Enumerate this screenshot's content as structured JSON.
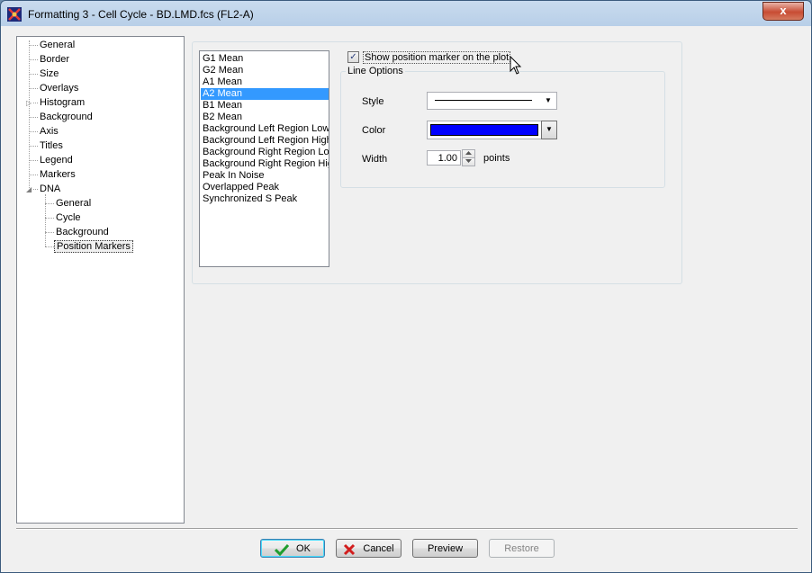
{
  "window": {
    "title": "Formatting 3 - Cell Cycle - BD.LMD.fcs (FL2-A)",
    "close_glyph": "x"
  },
  "tree": {
    "items": [
      {
        "label": "General"
      },
      {
        "label": "Border"
      },
      {
        "label": "Size"
      },
      {
        "label": "Overlays"
      },
      {
        "label": "Histogram"
      },
      {
        "label": "Background"
      },
      {
        "label": "Axis"
      },
      {
        "label": "Titles"
      },
      {
        "label": "Legend"
      },
      {
        "label": "Markers"
      },
      {
        "label": "DNA"
      }
    ],
    "dna_children": [
      {
        "label": "General"
      },
      {
        "label": "Cycle"
      },
      {
        "label": "Background"
      },
      {
        "label": "Position Markers"
      }
    ],
    "histogram_expander": "▷",
    "dna_expander": "◢"
  },
  "marker_list": {
    "items": [
      "G1 Mean",
      "G2 Mean",
      "A1 Mean",
      "A2 Mean",
      "B1 Mean",
      "B2 Mean",
      "Background Left Region Low",
      "Background Left Region High",
      "Background Right Region Low",
      "Background Right Region High",
      "Peak In Noise",
      "Overlapped Peak",
      "Synchronized S Peak"
    ],
    "selected": "A2 Mean"
  },
  "options": {
    "show_marker_label": "Show position marker on the plot",
    "show_marker_checked": "✓",
    "group_title": "Line Options",
    "style_label": "Style",
    "color_label": "Color",
    "color_value": "#0000ff",
    "width_label": "Width",
    "width_value": "1.00",
    "width_unit": "points",
    "dropdown_glyph": "▼"
  },
  "buttons": {
    "ok": "OK",
    "cancel": "Cancel",
    "preview": "Preview",
    "restore": "Restore"
  },
  "colors": {
    "selection": "#3399ff",
    "swatch": "#0000ff"
  }
}
